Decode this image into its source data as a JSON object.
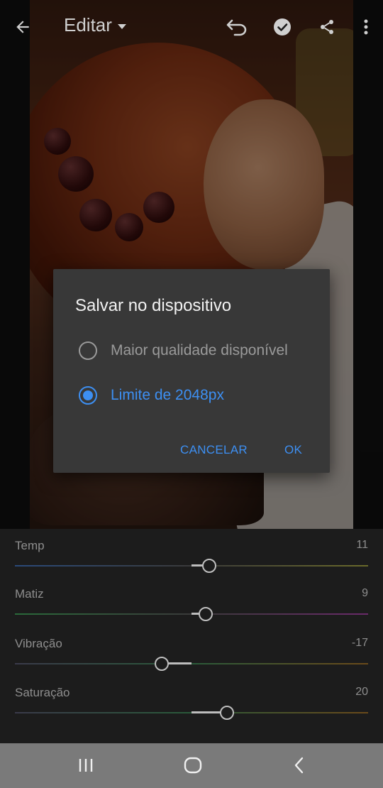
{
  "colors": {
    "accent": "#3d8ff2",
    "dialog_bg": "#383838",
    "panel_bg": "#1c1c1c",
    "nav_bg": "#7a7a7a"
  },
  "topbar": {
    "back_icon": "arrow-left-icon",
    "title": "Editar",
    "title_icon": "caret-down-icon",
    "undo_icon": "undo-icon",
    "confirm_icon": "check-circle-icon",
    "share_icon": "share-icon",
    "menu_icon": "more-vert-icon"
  },
  "dialog": {
    "title": "Salvar no dispositivo",
    "options": [
      {
        "label": "Maior qualidade disponível",
        "selected": false
      },
      {
        "label": "Limite de 2048px",
        "selected": true
      }
    ],
    "cancel_label": "CANCELAR",
    "ok_label": "OK"
  },
  "sliders": [
    {
      "label": "Temp",
      "value": "11",
      "level": 0.55
    },
    {
      "label": "Matiz",
      "value": "9",
      "level": 0.54
    },
    {
      "label": "Vibração",
      "value": "-17",
      "level": 0.415
    },
    {
      "label": "Saturação",
      "value": "20",
      "level": 0.6
    }
  ],
  "navbar": {
    "recents_icon": "recents-icon",
    "home_icon": "home-icon",
    "back_icon": "chevron-left-icon"
  }
}
